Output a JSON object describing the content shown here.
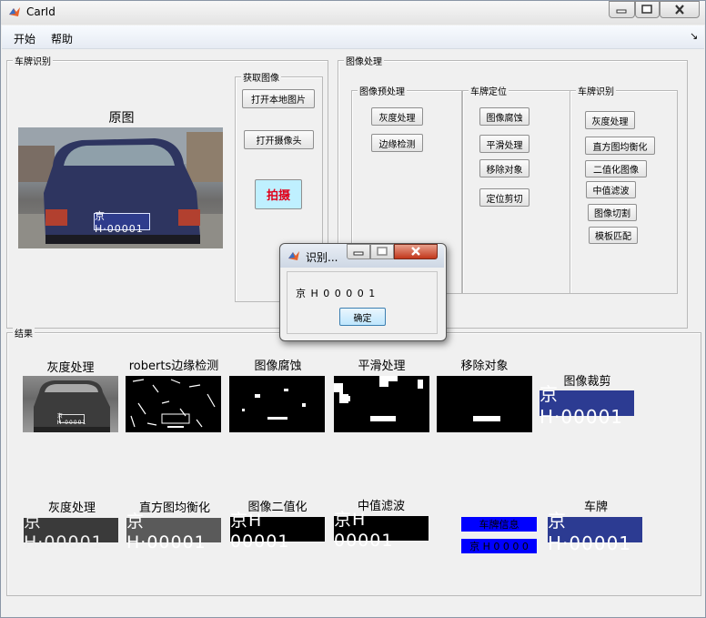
{
  "window": {
    "title": "CarId"
  },
  "menu": {
    "items": [
      "开始",
      "帮助"
    ],
    "corner_symbol": "↘"
  },
  "panels": {
    "plate_recognition": "车牌识别",
    "acquire_image": "获取图像",
    "image_processing": "图像处理",
    "preprocess": "图像预处理",
    "plate_locate": "车牌定位",
    "plate_identify": "车牌识别",
    "results": "结果"
  },
  "original_caption": "原图",
  "acquire_buttons": {
    "open_local": "打开本地图片",
    "open_camera": "打开摄像头",
    "capture": "拍摄"
  },
  "preprocess_buttons": [
    "灰度处理",
    "边缘检测"
  ],
  "locate_buttons": [
    "图像腐蚀",
    "平滑处理",
    "移除对象",
    "定位剪切"
  ],
  "identify_buttons": [
    "灰度处理",
    "直方图均衡化",
    "二值化图像",
    "中值滤波",
    "图像切割",
    "模板匹配"
  ],
  "results_row1": [
    "灰度处理",
    "roberts边缘检测",
    "图像腐蚀",
    "平滑处理",
    "移除对象",
    "图像裁剪"
  ],
  "results_row2": [
    "灰度处理",
    "直方图均衡化",
    "图像二值化",
    "中值滤波",
    "",
    "车牌"
  ],
  "plate_text": "京H·00001",
  "plate_bw_text": "京H 00001",
  "plate_info_label": "车牌信息",
  "plate_info_value": "京 H 0 0 0 0",
  "dialog": {
    "title": "识别...",
    "message": "京 H 0 0 0 0 1",
    "ok_label": "确定"
  },
  "colors": {
    "capture_button_bg": "#bff0ff",
    "capture_button_text": "#e0001a",
    "info_box": "#0000ff",
    "plate_blue": "#2e3c8c"
  }
}
